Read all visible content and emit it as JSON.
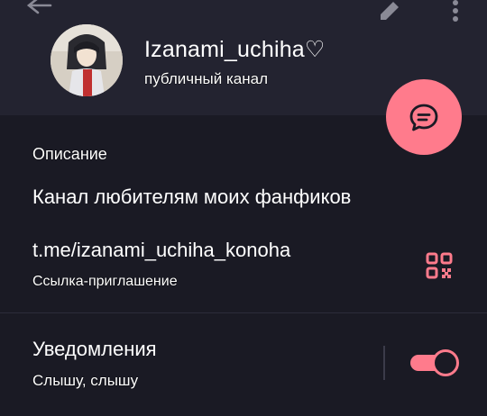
{
  "header": {
    "channel_name": "Izanami_uchiha♡",
    "channel_subtitle": "публичный канал",
    "back_icon": "arrow-left-icon",
    "edit_icon": "pencil-icon",
    "more_icon": "more-vertical-icon",
    "background_color": "#232330"
  },
  "fab": {
    "icon": "chat-bubble-icon",
    "color": "#ff7b8c"
  },
  "info": {
    "section_title": "Описание",
    "description": "Канал любителям моих фанфиков",
    "link": "t.me/izanami_uchiha_konoha",
    "link_caption": "Ссылка-приглашение",
    "qr_icon": "qr-code-icon"
  },
  "notifications": {
    "title": "Уведомления",
    "status": "Слышу, слышу",
    "enabled": true
  },
  "colors": {
    "accent": "#ff7b8c",
    "background": "#1a1a24"
  }
}
